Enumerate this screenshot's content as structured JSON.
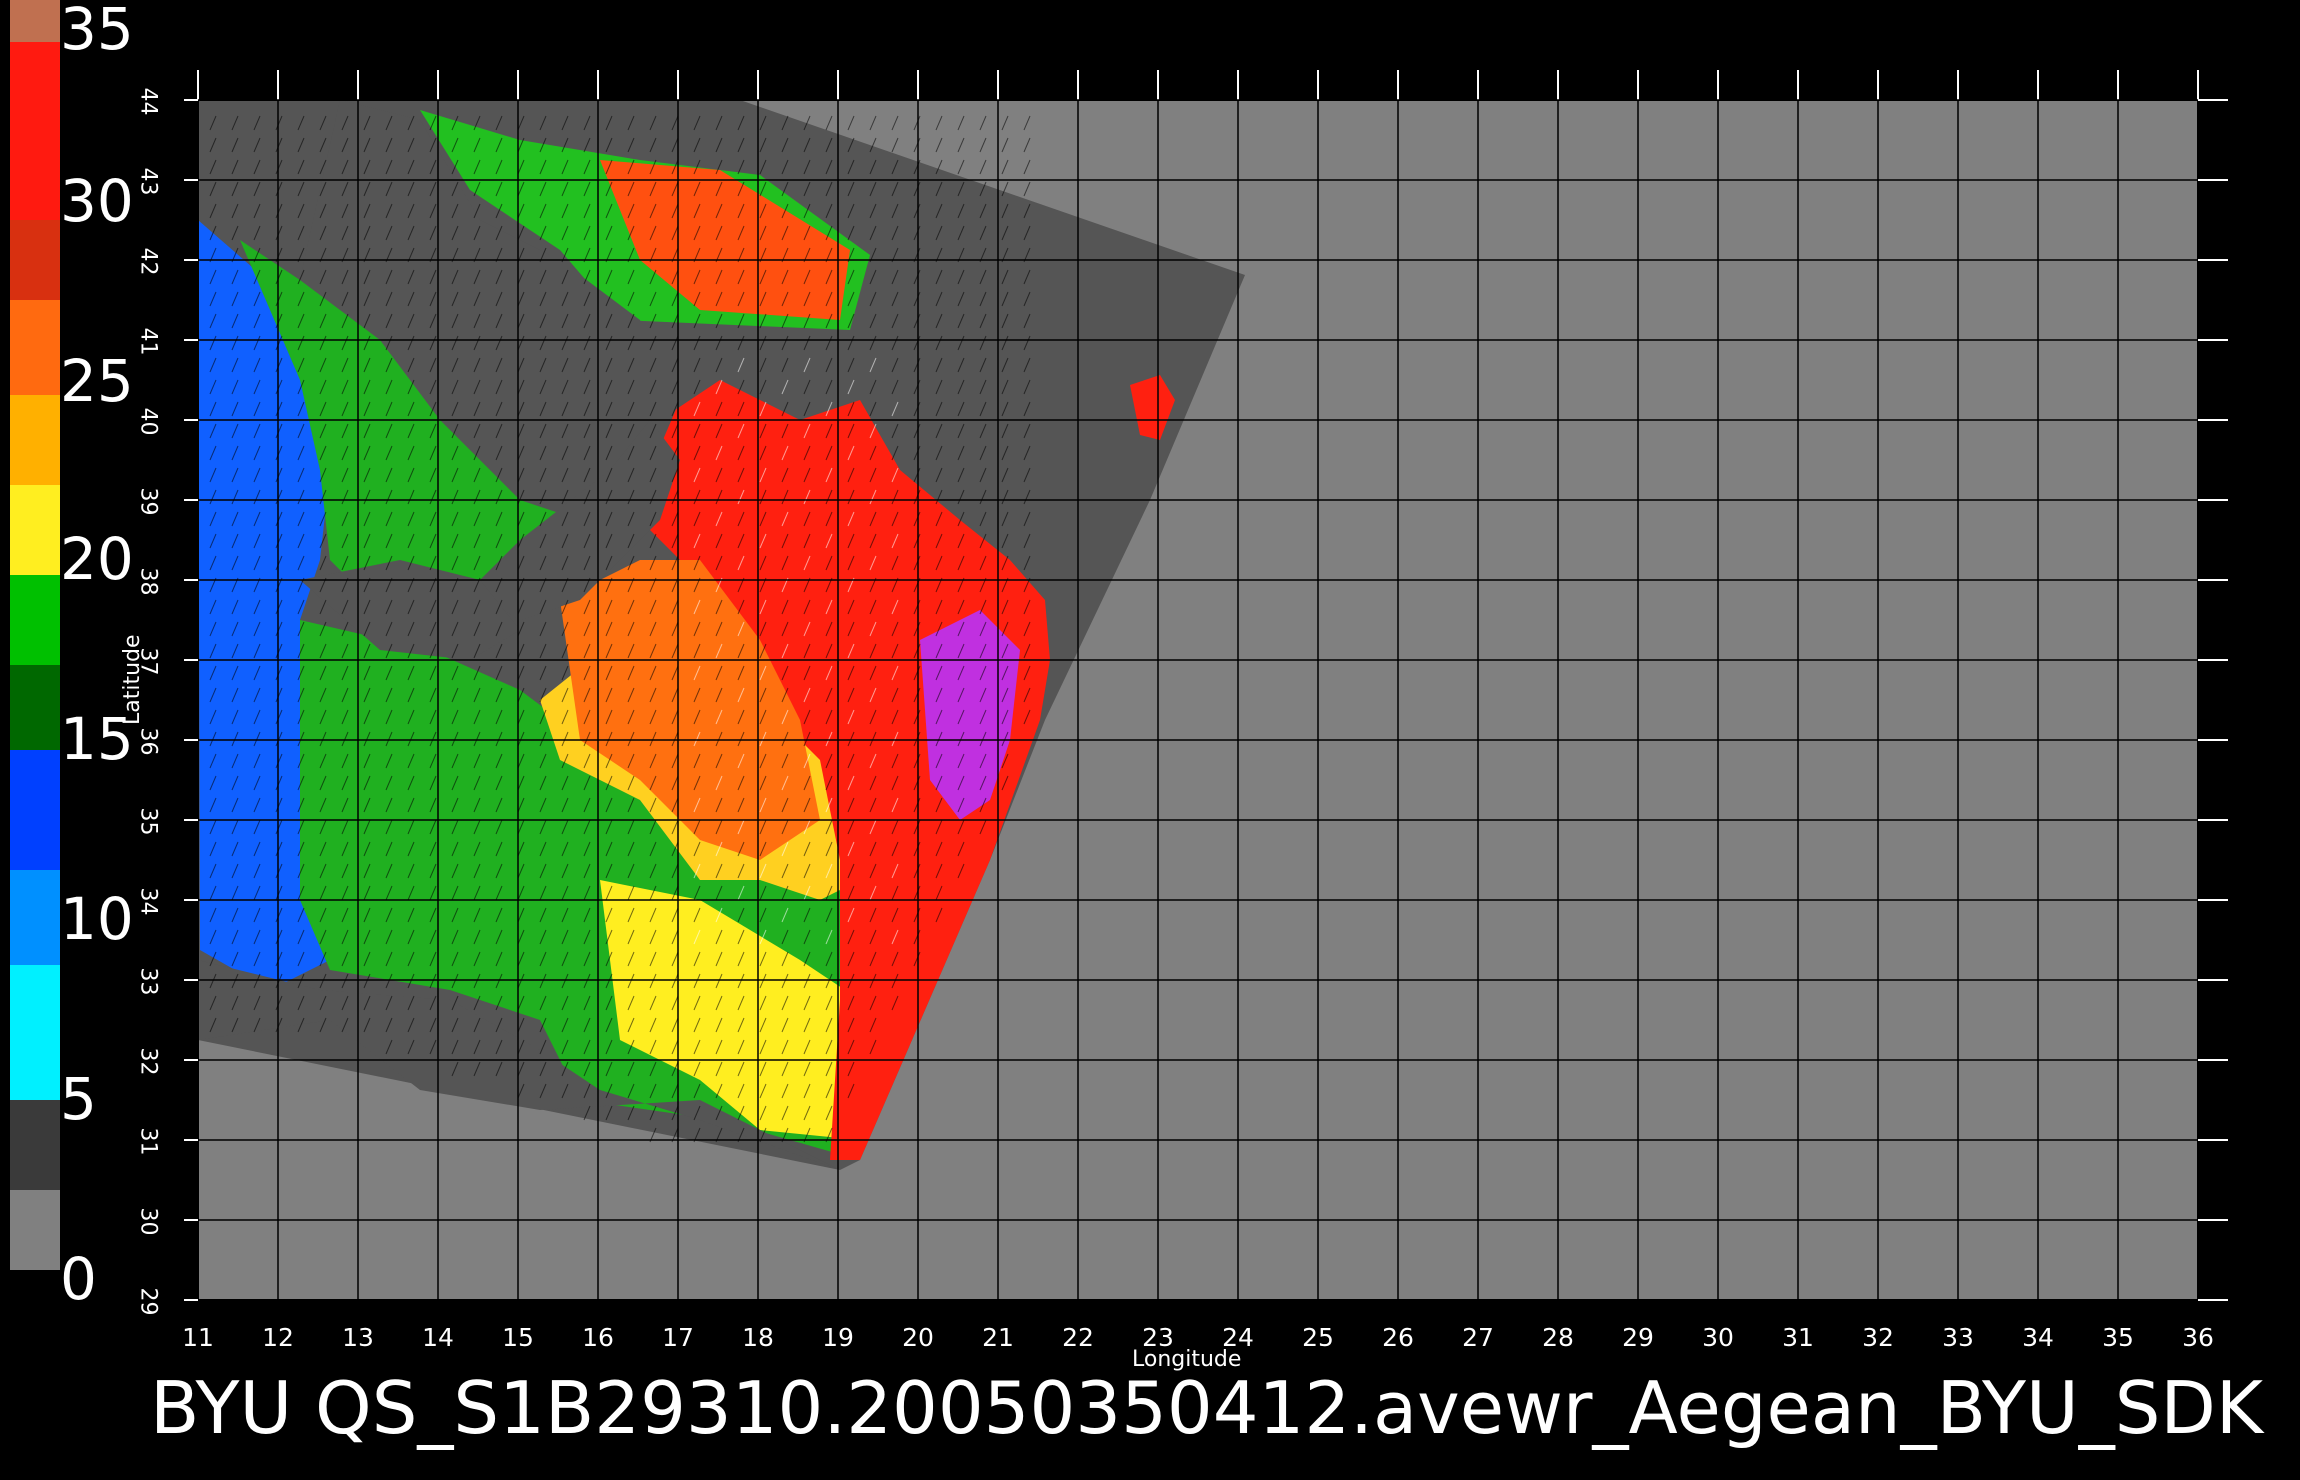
{
  "colorbar": {
    "labels": [
      "35",
      "30",
      "25",
      "20",
      "15",
      "10",
      "5",
      "0"
    ],
    "colors": [
      "#ff0000",
      "#ff3020",
      "#ff6010",
      "#ffa000",
      "#ffff20",
      "#00c000",
      "#006000",
      "#0000ff",
      "#0088ff",
      "#00ffff",
      "#404040",
      "#888888"
    ]
  },
  "map": {
    "x_ticks": [
      "11",
      "12",
      "13",
      "14",
      "15",
      "16",
      "17",
      "18",
      "19",
      "20",
      "21",
      "22",
      "23",
      "24",
      "25",
      "26",
      "27",
      "28",
      "29",
      "30",
      "31",
      "32",
      "33",
      "34",
      "35",
      "36"
    ],
    "y_ticks": [
      "29",
      "30",
      "31",
      "32",
      "33",
      "34",
      "35",
      "36",
      "37",
      "38",
      "39",
      "40",
      "41",
      "42",
      "43",
      "44"
    ],
    "x_label": "Longitude",
    "y_label": "Latitude",
    "background_color": "#808080",
    "swath_color": "#555555"
  },
  "footer": {
    "text": "BYU  QS_S1B29310.20050350412.avewr_Aegean_BYU_SDK"
  }
}
